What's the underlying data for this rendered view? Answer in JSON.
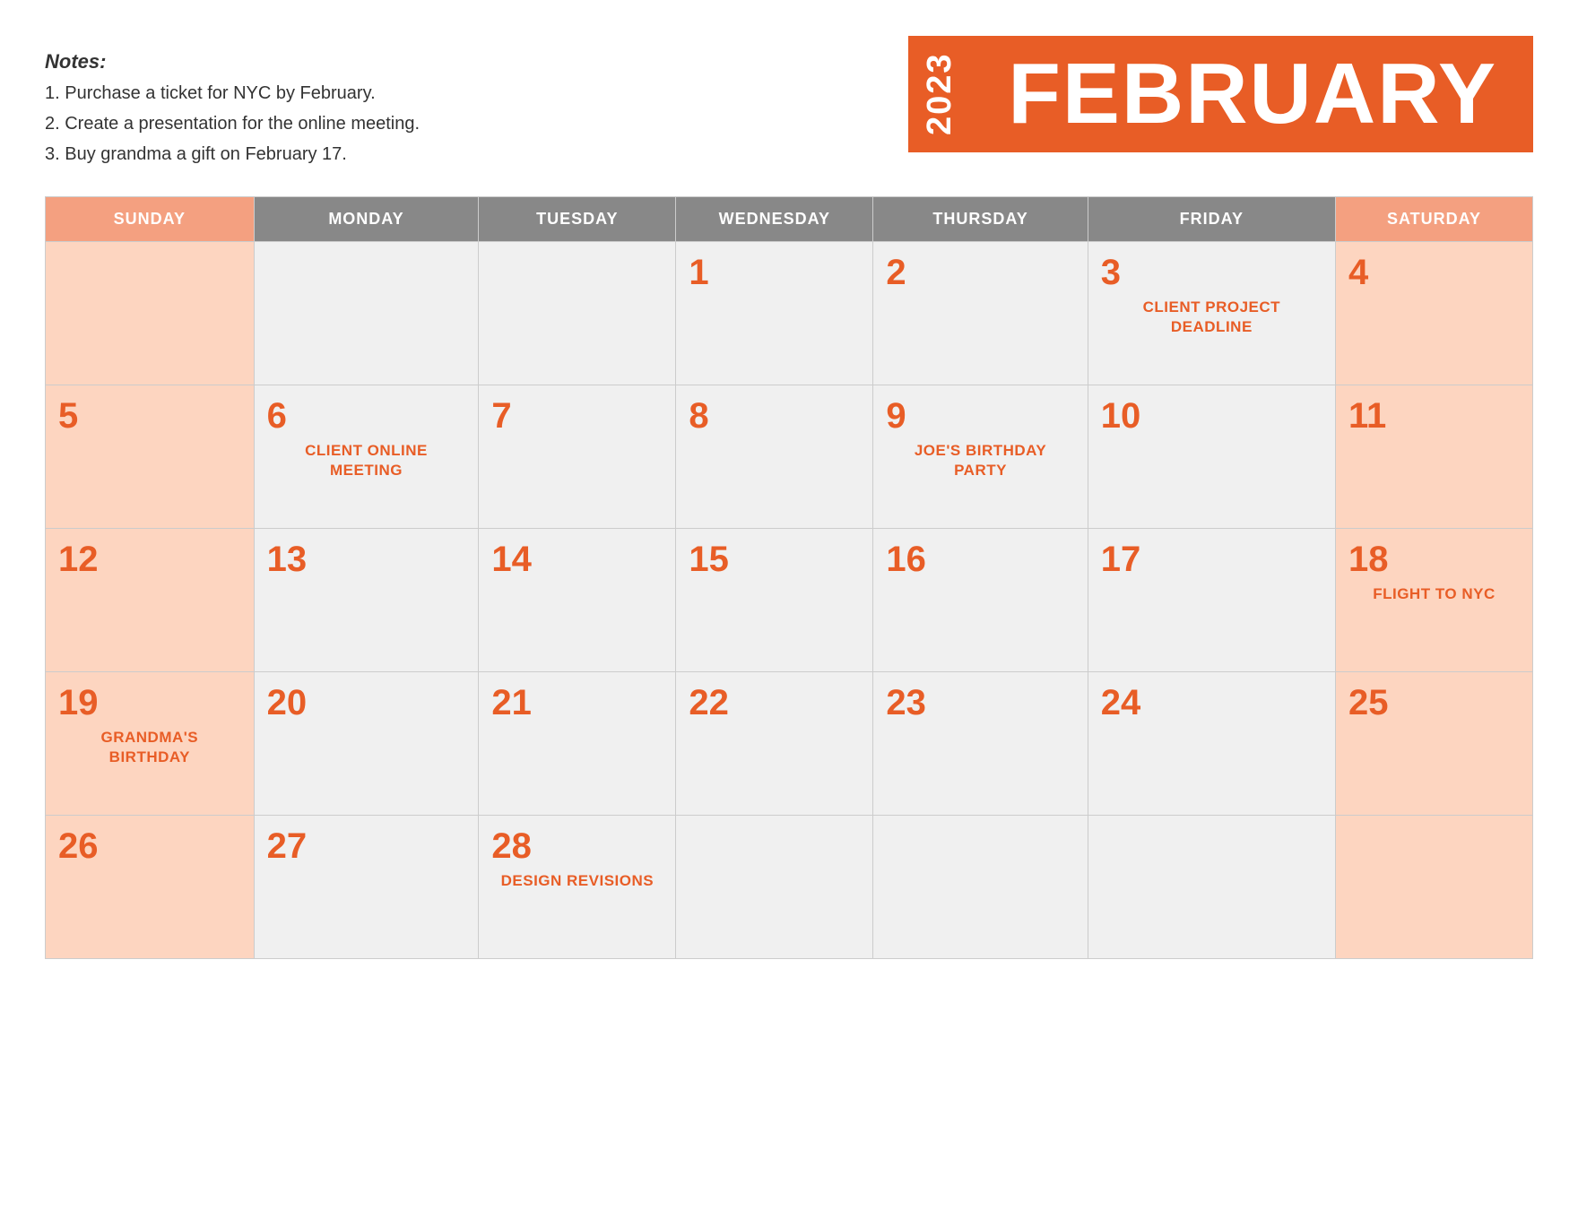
{
  "notes": {
    "title": "Notes:",
    "items": [
      "1. Purchase a ticket for NYC by February.",
      "2. Create a presentation for the online meeting.",
      "3. Buy grandma a gift on February 17."
    ]
  },
  "header": {
    "year": "2023",
    "month": "FEBRUARY"
  },
  "calendar": {
    "days_of_week": [
      {
        "label": "SUNDAY",
        "type": "weekend"
      },
      {
        "label": "MONDAY",
        "type": "weekday"
      },
      {
        "label": "TUESDAY",
        "type": "weekday"
      },
      {
        "label": "WEDNESDAY",
        "type": "weekday"
      },
      {
        "label": "THURSDAY",
        "type": "weekday"
      },
      {
        "label": "FRIDAY",
        "type": "weekday"
      },
      {
        "label": "SATURDAY",
        "type": "weekend"
      }
    ],
    "weeks": [
      [
        {
          "day": "",
          "event": "",
          "type": "empty-weekend"
        },
        {
          "day": "",
          "event": "",
          "type": "empty-day"
        },
        {
          "day": "",
          "event": "",
          "type": "empty-day"
        },
        {
          "day": "1",
          "event": "",
          "type": "weekday-day"
        },
        {
          "day": "2",
          "event": "",
          "type": "weekday-day"
        },
        {
          "day": "3",
          "event": "CLIENT PROJECT DEADLINE",
          "type": "weekday-day"
        },
        {
          "day": "4",
          "event": "",
          "type": "weekend-day"
        }
      ],
      [
        {
          "day": "5",
          "event": "",
          "type": "weekend-day"
        },
        {
          "day": "6",
          "event": "CLIENT ONLINE MEETING",
          "type": "weekday-day"
        },
        {
          "day": "7",
          "event": "",
          "type": "weekday-day"
        },
        {
          "day": "8",
          "event": "",
          "type": "weekday-day"
        },
        {
          "day": "9",
          "event": "JOE'S BIRTHDAY PARTY",
          "type": "weekday-day"
        },
        {
          "day": "10",
          "event": "",
          "type": "weekday-day"
        },
        {
          "day": "11",
          "event": "",
          "type": "weekend-day"
        }
      ],
      [
        {
          "day": "12",
          "event": "",
          "type": "weekend-day"
        },
        {
          "day": "13",
          "event": "",
          "type": "weekday-day"
        },
        {
          "day": "14",
          "event": "",
          "type": "weekday-day"
        },
        {
          "day": "15",
          "event": "",
          "type": "weekday-day"
        },
        {
          "day": "16",
          "event": "",
          "type": "weekday-day"
        },
        {
          "day": "17",
          "event": "",
          "type": "weekday-day"
        },
        {
          "day": "18",
          "event": "FLIGHT TO NYC",
          "type": "weekend-day"
        }
      ],
      [
        {
          "day": "19",
          "event": "GRANDMA'S BIRTHDAY",
          "type": "weekend-day"
        },
        {
          "day": "20",
          "event": "",
          "type": "weekday-day"
        },
        {
          "day": "21",
          "event": "",
          "type": "weekday-day"
        },
        {
          "day": "22",
          "event": "",
          "type": "weekday-day"
        },
        {
          "day": "23",
          "event": "",
          "type": "weekday-day"
        },
        {
          "day": "24",
          "event": "",
          "type": "weekday-day"
        },
        {
          "day": "25",
          "event": "",
          "type": "weekend-day"
        }
      ],
      [
        {
          "day": "26",
          "event": "",
          "type": "weekend-day"
        },
        {
          "day": "27",
          "event": "",
          "type": "weekday-day"
        },
        {
          "day": "28",
          "event": "DESIGN REVISIONS",
          "type": "weekday-day"
        },
        {
          "day": "",
          "event": "",
          "type": "empty-day"
        },
        {
          "day": "",
          "event": "",
          "type": "empty-day"
        },
        {
          "day": "",
          "event": "",
          "type": "empty-day"
        },
        {
          "day": "",
          "event": "",
          "type": "empty-weekend"
        }
      ]
    ]
  }
}
